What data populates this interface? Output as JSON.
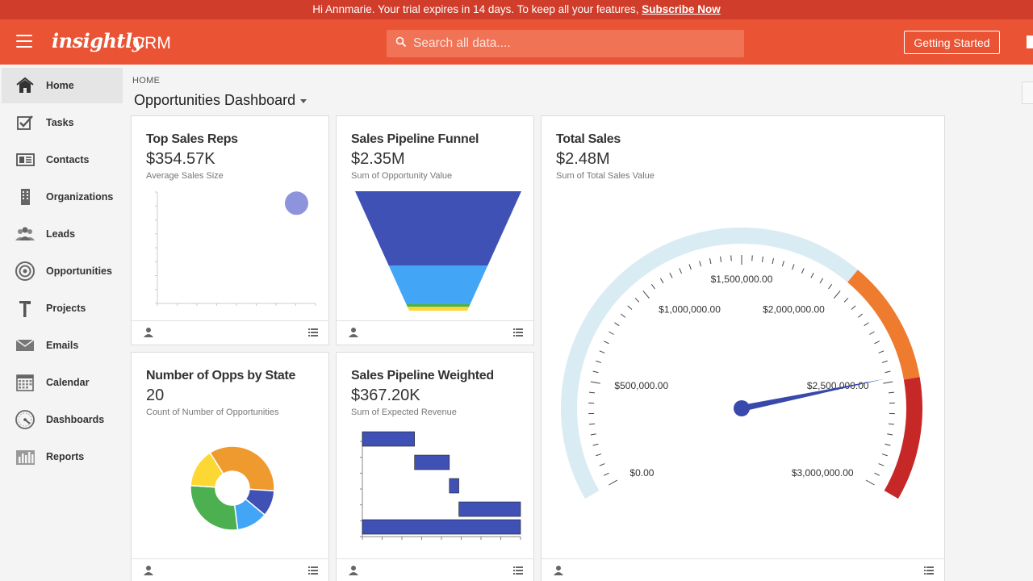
{
  "banner": {
    "text": "Hi Annmarie. Your trial expires in 14 days. To keep all your features, ",
    "link": "Subscribe Now"
  },
  "header": {
    "logo": "insightly",
    "product": "CRM",
    "search_placeholder": "Search all data....",
    "getting_started": "Getting Started"
  },
  "sidebar": {
    "items": [
      {
        "label": "Home",
        "icon": "home-icon",
        "active": true
      },
      {
        "label": "Tasks",
        "icon": "tasks-icon"
      },
      {
        "label": "Contacts",
        "icon": "contacts-icon"
      },
      {
        "label": "Organizations",
        "icon": "organizations-icon"
      },
      {
        "label": "Leads",
        "icon": "leads-icon"
      },
      {
        "label": "Opportunities",
        "icon": "opportunities-icon"
      },
      {
        "label": "Projects",
        "icon": "projects-icon"
      },
      {
        "label": "Emails",
        "icon": "emails-icon"
      },
      {
        "label": "Calendar",
        "icon": "calendar-icon"
      },
      {
        "label": "Dashboards",
        "icon": "dashboards-icon"
      },
      {
        "label": "Reports",
        "icon": "reports-icon"
      }
    ]
  },
  "page": {
    "breadcrumb": "HOME",
    "title": "Opportunities Dashboard"
  },
  "colors": {
    "brand": "#ea5434",
    "banner": "#d03d2a",
    "funnel_top": "#3f51b5",
    "funnel_mid": "#42a5f5",
    "funnel_green": "#4caf50",
    "funnel_yellow": "#fdd835",
    "gauge_light": "#d9ebf3",
    "gauge_orange": "#ef7b2e",
    "gauge_red": "#c62828",
    "needle": "#3949ab"
  },
  "cards": {
    "top_sales_reps": {
      "title": "Top Sales Reps",
      "value": "$354.57K",
      "subtitle": "Average Sales Size"
    },
    "sales_pipeline_funnel": {
      "title": "Sales Pipeline Funnel",
      "value": "$2.35M",
      "subtitle": "Sum of Opportunity Value"
    },
    "total_sales": {
      "title": "Total Sales",
      "value": "$2.48M",
      "subtitle": "Sum of Total Sales Value"
    },
    "opps_by_state": {
      "title": "Number of Opps by State",
      "value": "20",
      "subtitle": "Count of Number of Opportunities"
    },
    "sales_pipeline_weighted": {
      "title": "Sales Pipeline Weighted",
      "value": "$367.20K",
      "subtitle": "Sum of Expected Revenue"
    }
  },
  "chart_data": [
    {
      "type": "scatter",
      "points": [
        {
          "x": 0.88,
          "y": 0.9
        }
      ],
      "title": "",
      "xlabel": "",
      "ylabel": "",
      "ylim": [
        0,
        1
      ],
      "grid": false,
      "color": "#8e94dc"
    },
    {
      "type": "bar",
      "orientation": "funnel",
      "values": [
        2.35,
        1.2,
        0.1,
        0.12
      ],
      "colors": [
        "#3f51b5",
        "#42a5f5",
        "#4caf50",
        "#fdd835"
      ],
      "title": "",
      "xlabel": "",
      "ylabel": ""
    },
    {
      "type": "pie",
      "style": "donut",
      "slices": [
        {
          "value": 35,
          "color": "#ef9a2e"
        },
        {
          "value": 10,
          "color": "#3f51b5"
        },
        {
          "value": 12,
          "color": "#42a5f5"
        },
        {
          "value": 28,
          "color": "#4caf50"
        },
        {
          "value": 15,
          "color": "#fdd835"
        }
      ],
      "title": ""
    },
    {
      "type": "bar",
      "orientation": "waterfall",
      "steps": [
        {
          "start": 0,
          "end": 0.33
        },
        {
          "start": 0.33,
          "end": 0.55
        },
        {
          "start": 0.55,
          "end": 0.61
        },
        {
          "start": 0.61,
          "end": 1.0
        },
        {
          "start": 0,
          "end": 1.0
        }
      ],
      "color": "#3f51b5",
      "title": ""
    },
    {
      "type": "gauge",
      "value": 2480000,
      "min": 0,
      "max": 3000000,
      "ticks": [
        {
          "value": 0,
          "label": "$0.00"
        },
        {
          "value": 500000,
          "label": "$500,000.00"
        },
        {
          "value": 1000000,
          "label": "$1,000,000.00"
        },
        {
          "value": 1500000,
          "label": "$1,500,000.00"
        },
        {
          "value": 2000000,
          "label": "$2,000,000.00"
        },
        {
          "value": 2500000,
          "label": "$2,500,000.00"
        },
        {
          "value": 3000000,
          "label": "$3,000,000.00"
        }
      ],
      "bands": [
        {
          "from": 0,
          "to": 2000000,
          "color": "#d9ebf3"
        },
        {
          "from": 2000000,
          "to": 2500000,
          "color": "#ef7b2e"
        },
        {
          "from": 2500000,
          "to": 3000000,
          "color": "#c62828"
        }
      ]
    }
  ]
}
